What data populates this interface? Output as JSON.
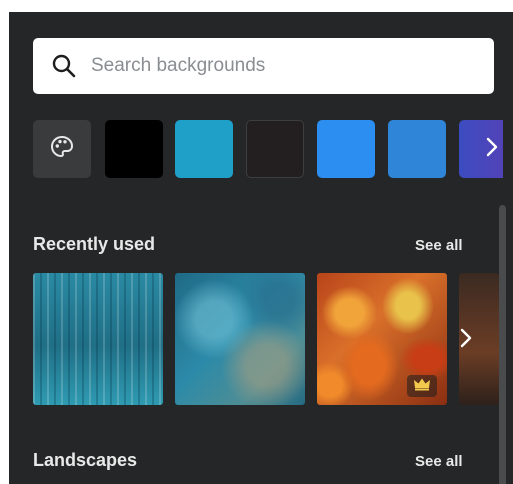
{
  "search": {
    "placeholder": "Search backgrounds",
    "value": "",
    "icon": "search-icon"
  },
  "swatches": {
    "palette_icon": "palette-icon",
    "colors": [
      "#000000",
      "#1ea0c8",
      "#231f20",
      "#2b8ef0",
      "#2f86d9",
      "#3b4cc0"
    ],
    "next_icon": "chevron-right-icon"
  },
  "recently_used": {
    "title": "Recently used",
    "see_all": "See all",
    "items": [
      {
        "name": "Teal wood planks"
      },
      {
        "name": "Teal textured paint"
      },
      {
        "name": "Autumn maple leaves",
        "badge": "crown-icon"
      },
      {
        "name": "Brown partial image"
      }
    ],
    "next_icon": "chevron-right-icon"
  },
  "landscapes": {
    "title": "Landscapes",
    "see_all": "See all"
  },
  "colors": {
    "panel_bg": "#252627",
    "text": "#e8e8e8",
    "swatch_btn_bg": "#3a3b3d"
  }
}
